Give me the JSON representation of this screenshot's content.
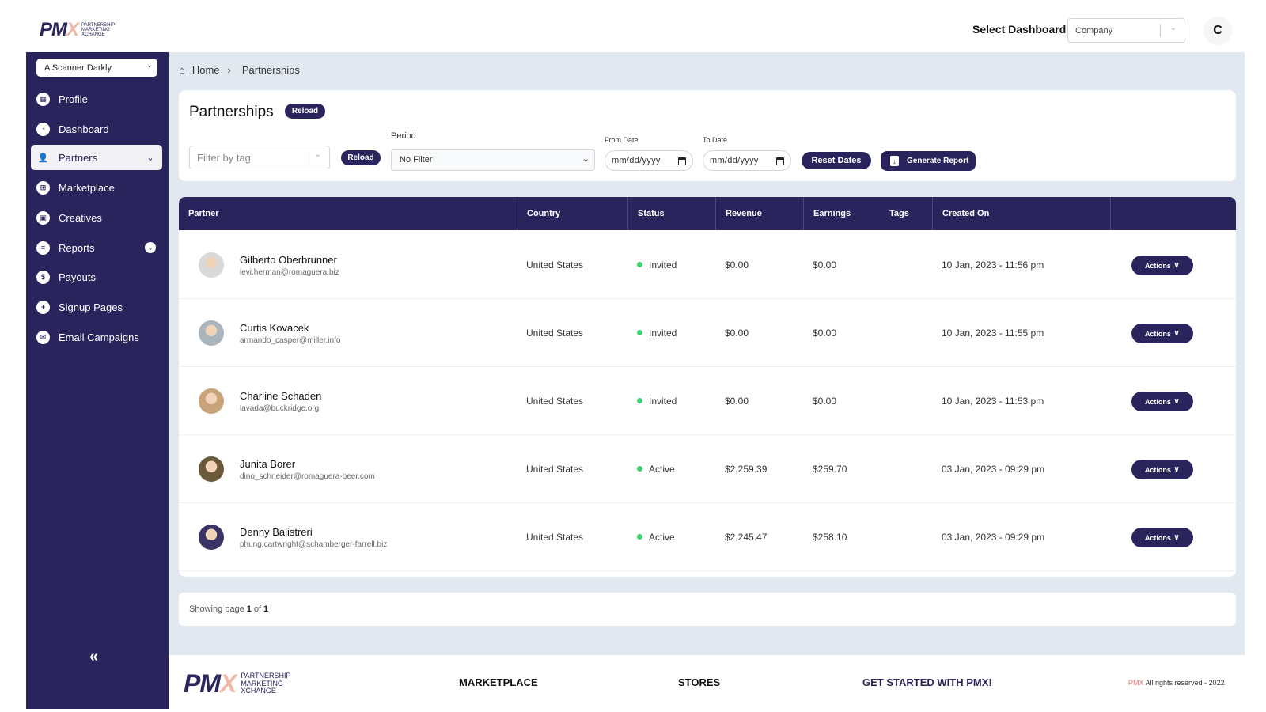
{
  "app": {
    "logo_mark": "PM",
    "logo_x": "X",
    "logo_text": [
      "PARTNERSHIP",
      "MARKETING",
      "XCHANGE"
    ]
  },
  "header": {
    "select_dashboard_label": "Select Dashboard",
    "dashboard_value": "Company",
    "user_initial": "C"
  },
  "sidebar": {
    "brand_select_value": "A Scanner Darkly",
    "items": [
      {
        "label": "Profile",
        "icon": "building-icon",
        "glyph": "▦"
      },
      {
        "label": "Dashboard",
        "icon": "pie-chart-icon",
        "glyph": "◔"
      },
      {
        "label": "Partners",
        "icon": "user-icon",
        "glyph": "👤",
        "active": true,
        "expandable": true
      },
      {
        "label": "Marketplace",
        "icon": "store-icon",
        "glyph": "⊞"
      },
      {
        "label": "Creatives",
        "icon": "film-icon",
        "glyph": "▣"
      },
      {
        "label": "Reports",
        "icon": "document-icon",
        "glyph": "≡",
        "expandable": true
      },
      {
        "label": "Payouts",
        "icon": "dollar-icon",
        "glyph": "$"
      },
      {
        "label": "Signup Pages",
        "icon": "user-plus-icon",
        "glyph": "+"
      },
      {
        "label": "Email Campaigns",
        "icon": "envelope-icon",
        "glyph": "✉"
      }
    ],
    "collapse_glyph": "«"
  },
  "breadcrumb": {
    "home": "Home",
    "separator": "›",
    "current": "Partnerships"
  },
  "filters": {
    "title": "Partnerships",
    "reload_label": "Reload",
    "tag_placeholder": "Filter by tag",
    "reload2_label": "Reload",
    "period_label": "Period",
    "period_value": "No Filter",
    "from_label": "From Date",
    "from_placeholder": "mm/dd/yyyy",
    "to_label": "To Date",
    "to_placeholder": "mm/dd/yyyy",
    "reset_label": "Reset Dates",
    "report_label": "Generate Report"
  },
  "table": {
    "columns": [
      "Partner",
      "Country",
      "Status",
      "Revenue",
      "Earnings",
      "Tags",
      "Created On",
      ""
    ],
    "action_label": "Actions",
    "status_color": "#3cd070",
    "rows": [
      {
        "name": "Gilberto Oberbrunner",
        "email": "levi.herman@romaguera.biz",
        "country": "United States",
        "status": "Invited",
        "revenue": "$0.00",
        "earnings": "$0.00",
        "tags": "",
        "created": "10 Jan, 2023 - 11:56 pm",
        "avatar_color": "#d9d9d9"
      },
      {
        "name": "Curtis Kovacek",
        "email": "armando_casper@miller.info",
        "country": "United States",
        "status": "Invited",
        "revenue": "$0.00",
        "earnings": "$0.00",
        "tags": "",
        "created": "10 Jan, 2023 - 11:55 pm",
        "avatar_color": "#a9b4bd"
      },
      {
        "name": "Charline Schaden",
        "email": "lavada@buckridge.org",
        "country": "United States",
        "status": "Invited",
        "revenue": "$0.00",
        "earnings": "$0.00",
        "tags": "",
        "created": "10 Jan, 2023 - 11:53 pm",
        "avatar_color": "#c9a37a"
      },
      {
        "name": "Junita Borer",
        "email": "dino_schneider@romaguera-beer.com",
        "country": "United States",
        "status": "Active",
        "revenue": "$2,259.39",
        "earnings": "$259.70",
        "tags": "",
        "created": "03 Jan, 2023 - 09:29 pm",
        "avatar_color": "#6b5a3a"
      },
      {
        "name": "Denny Balistreri",
        "email": "phung.cartwright@schamberger-farrell.biz",
        "country": "United States",
        "status": "Active",
        "revenue": "$2,245.47",
        "earnings": "$258.10",
        "tags": "",
        "created": "03 Jan, 2023 - 09:29 pm",
        "avatar_color": "#3a3466"
      }
    ]
  },
  "pager": {
    "prefix": "Showing page",
    "page": "1",
    "of": "of",
    "total": "1"
  },
  "footer": {
    "links": [
      "MARKETPLACE",
      "STORES",
      "GET STARTED WITH PMX!"
    ],
    "copyright_brand": "PMX",
    "copyright_text": "All rights reserved - 2022"
  },
  "colors": {
    "primary": "#2a245c",
    "background": "#e2e8f0",
    "accent": "#f0b8a6",
    "status_active": "#3cd070"
  }
}
